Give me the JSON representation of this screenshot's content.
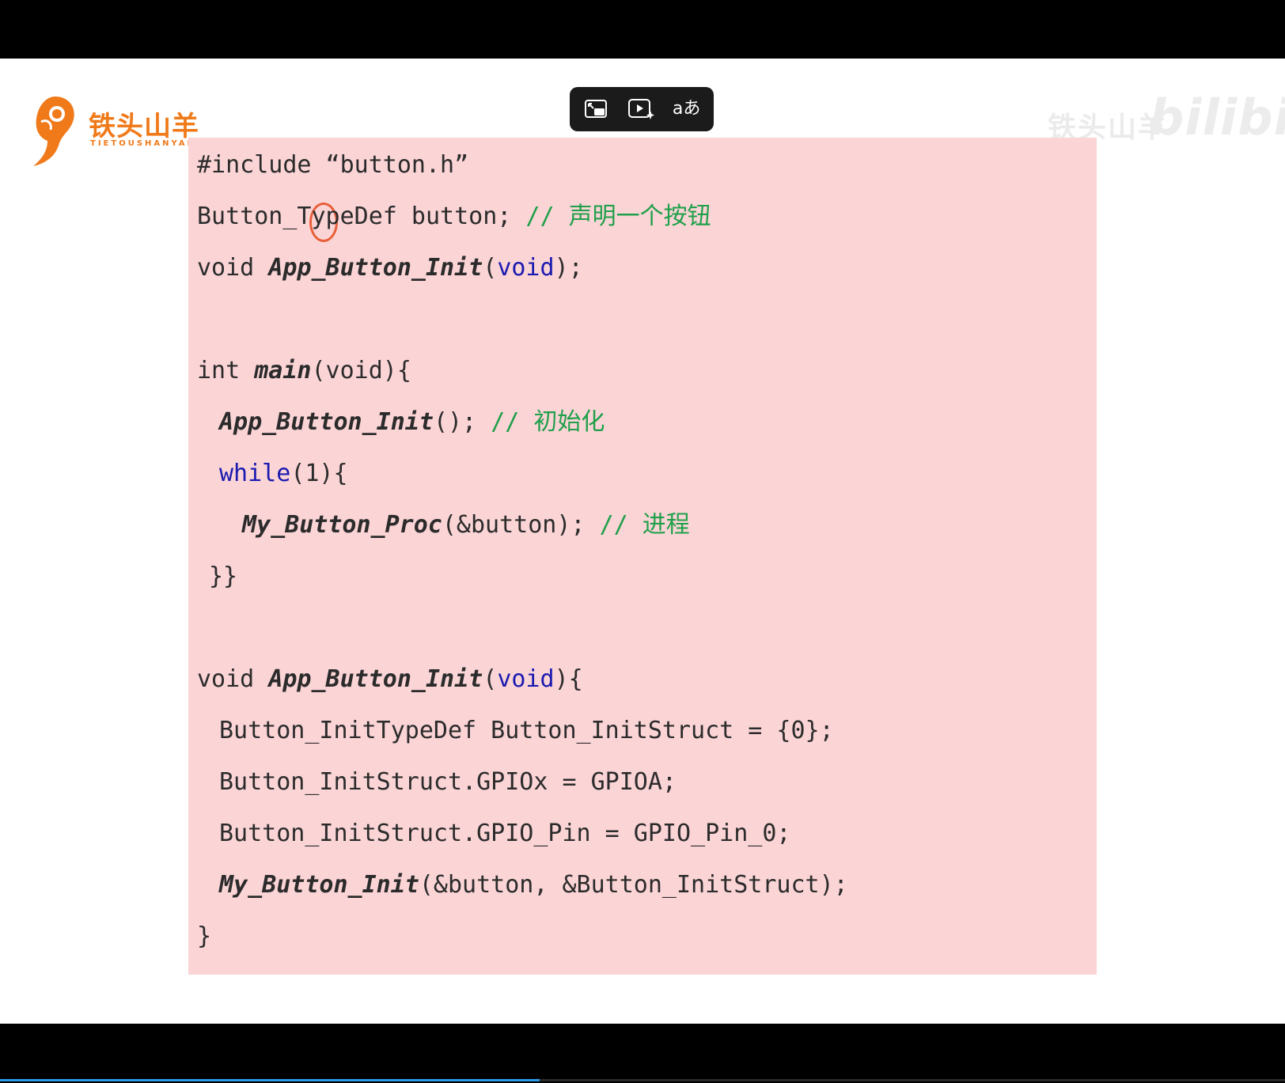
{
  "logo": {
    "cn": "铁头山羊",
    "en": "TIETOUSHANYANG"
  },
  "watermark": {
    "author": "铁头山羊",
    "brand": "bilibili"
  },
  "toolbar": {
    "items": [
      {
        "icon": "picture-in-picture-icon"
      },
      {
        "icon": "ai-video-icon"
      },
      {
        "icon": "translate-icon",
        "label": "aあ"
      }
    ]
  },
  "code": {
    "line1": "#include “button.h”",
    "line2_a": "Button_TypeDef button; ",
    "line2_comment": "// 声明一个按钮",
    "line3_a": "void ",
    "line3_fn": "App_Button_Init",
    "line3_b": "(",
    "line3_kw": "void",
    "line3_c": ");",
    "line5_a": "int ",
    "line5_fn": "main",
    "line5_b": "(void){",
    "line6_fn": "App_Button_Init",
    "line6_b": "(); ",
    "line6_comment": "// 初始化",
    "line7_kw": "while",
    "line7_b": "(1){",
    "line8_fn": "My_Button_Proc",
    "line8_b": "(&button); ",
    "line8_comment": "// 进程",
    "line9": "}}",
    "line11_a": "void ",
    "line11_fn": "App_Button_Init",
    "line11_b": "(",
    "line11_kw": "void",
    "line11_c": "){",
    "line12": "Button_InitTypeDef Button_InitStruct = {0};",
    "line13": "Button_InitStruct.GPIOx = GPIOA;",
    "line14": "Button_InitStruct.GPIO_Pin = GPIO_Pin_0;",
    "line15_fn": "My_Button_Init",
    "line15_b": "(&button, &Button_InitStruct);",
    "line16": "}"
  },
  "colors": {
    "card_bg": "#fbd4d6",
    "keyword": "#1a1ab0",
    "comment": "#1fa04a",
    "logo": "#f07a1a",
    "highlight": "#e8603a",
    "progress": "#2e9be6"
  },
  "playback": {
    "progress_fraction": 0.42
  }
}
